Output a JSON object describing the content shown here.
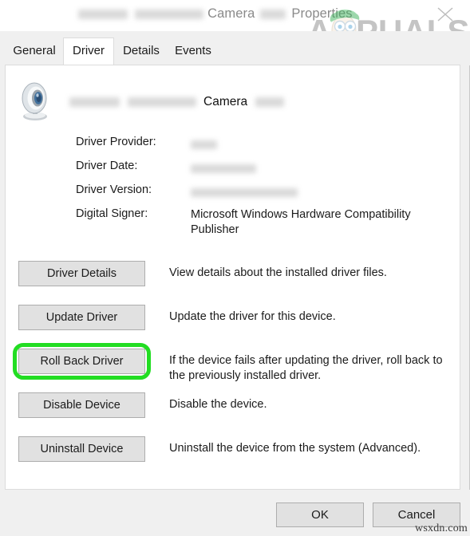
{
  "window": {
    "title_prefix_redacted": true,
    "title_visible_1": "Camera",
    "title_visible_2": "Properties",
    "close_icon": "close-icon"
  },
  "branding": {
    "logo_text": "APPUALS",
    "logo_accent": "#4cc56a",
    "watermark": "wsxdn.com"
  },
  "tabs": [
    {
      "label": "General",
      "active": false
    },
    {
      "label": "Driver",
      "active": true
    },
    {
      "label": "Details",
      "active": false
    },
    {
      "label": "Events",
      "active": false
    }
  ],
  "device": {
    "icon": "webcam-icon",
    "name_visible": "Camera"
  },
  "driver_info": [
    {
      "label": "Driver Provider:",
      "value": "",
      "redacted": true
    },
    {
      "label": "Driver Date:",
      "value": "",
      "redacted": true
    },
    {
      "label": "Driver Version:",
      "value": "",
      "redacted": true
    },
    {
      "label": "Digital Signer:",
      "value": "Microsoft Windows Hardware Compatibility Publisher",
      "redacted": false
    }
  ],
  "actions": [
    {
      "button": "Driver Details",
      "description": "View details about the installed driver files.",
      "highlighted": false
    },
    {
      "button": "Update Driver",
      "description": "Update the driver for this device.",
      "highlighted": false
    },
    {
      "button": "Roll Back Driver",
      "description": "If the device fails after updating the driver, roll back to the previously installed driver.",
      "highlighted": true
    },
    {
      "button": "Disable Device",
      "description": "Disable the device.",
      "highlighted": false
    },
    {
      "button": "Uninstall Device",
      "description": "Uninstall the device from the system (Advanced).",
      "highlighted": false
    }
  ],
  "footer": {
    "ok_label": "OK",
    "cancel_label": "Cancel"
  },
  "colors": {
    "highlight_green": "#22dd22",
    "window_chrome": "#f0f0f0",
    "button_face": "#e1e1e1"
  }
}
